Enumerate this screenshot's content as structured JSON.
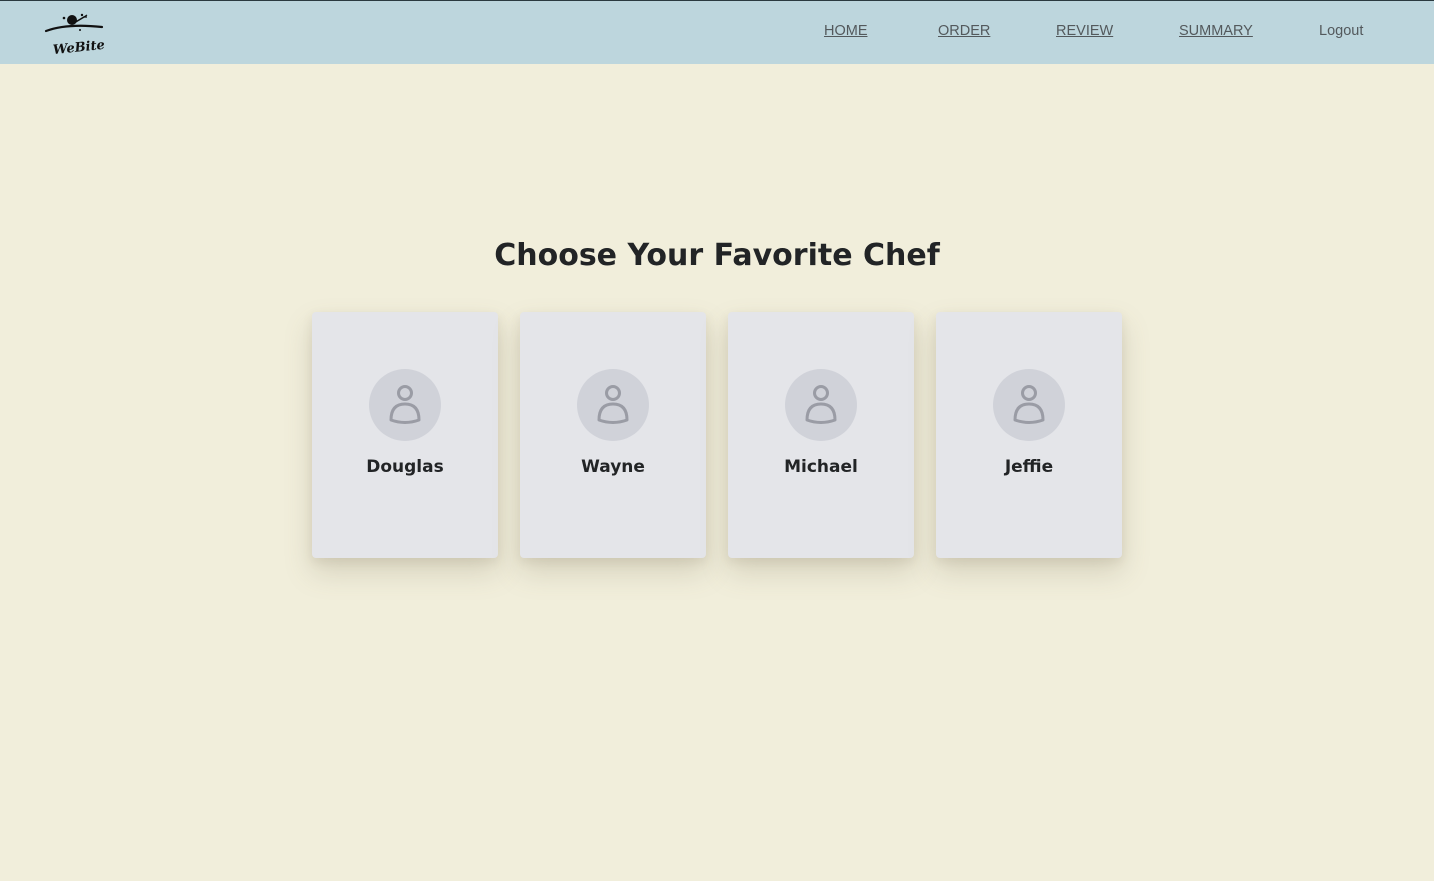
{
  "header": {
    "logo_text": "WeBite",
    "nav": [
      {
        "label": "HOME"
      },
      {
        "label": "ORDER"
      },
      {
        "label": "REVIEW"
      },
      {
        "label": "SUMMARY"
      },
      {
        "label": "Logout"
      }
    ],
    "background": "#bdd6dd"
  },
  "main": {
    "title": "Choose Your Favorite Chef",
    "background": "#f1eedb",
    "chefs": [
      {
        "name": "Douglas",
        "icon": "user-icon"
      },
      {
        "name": "Wayne",
        "icon": "user-icon"
      },
      {
        "name": "Michael",
        "icon": "user-icon"
      },
      {
        "name": "Jeffie",
        "icon": "user-icon"
      }
    ]
  }
}
